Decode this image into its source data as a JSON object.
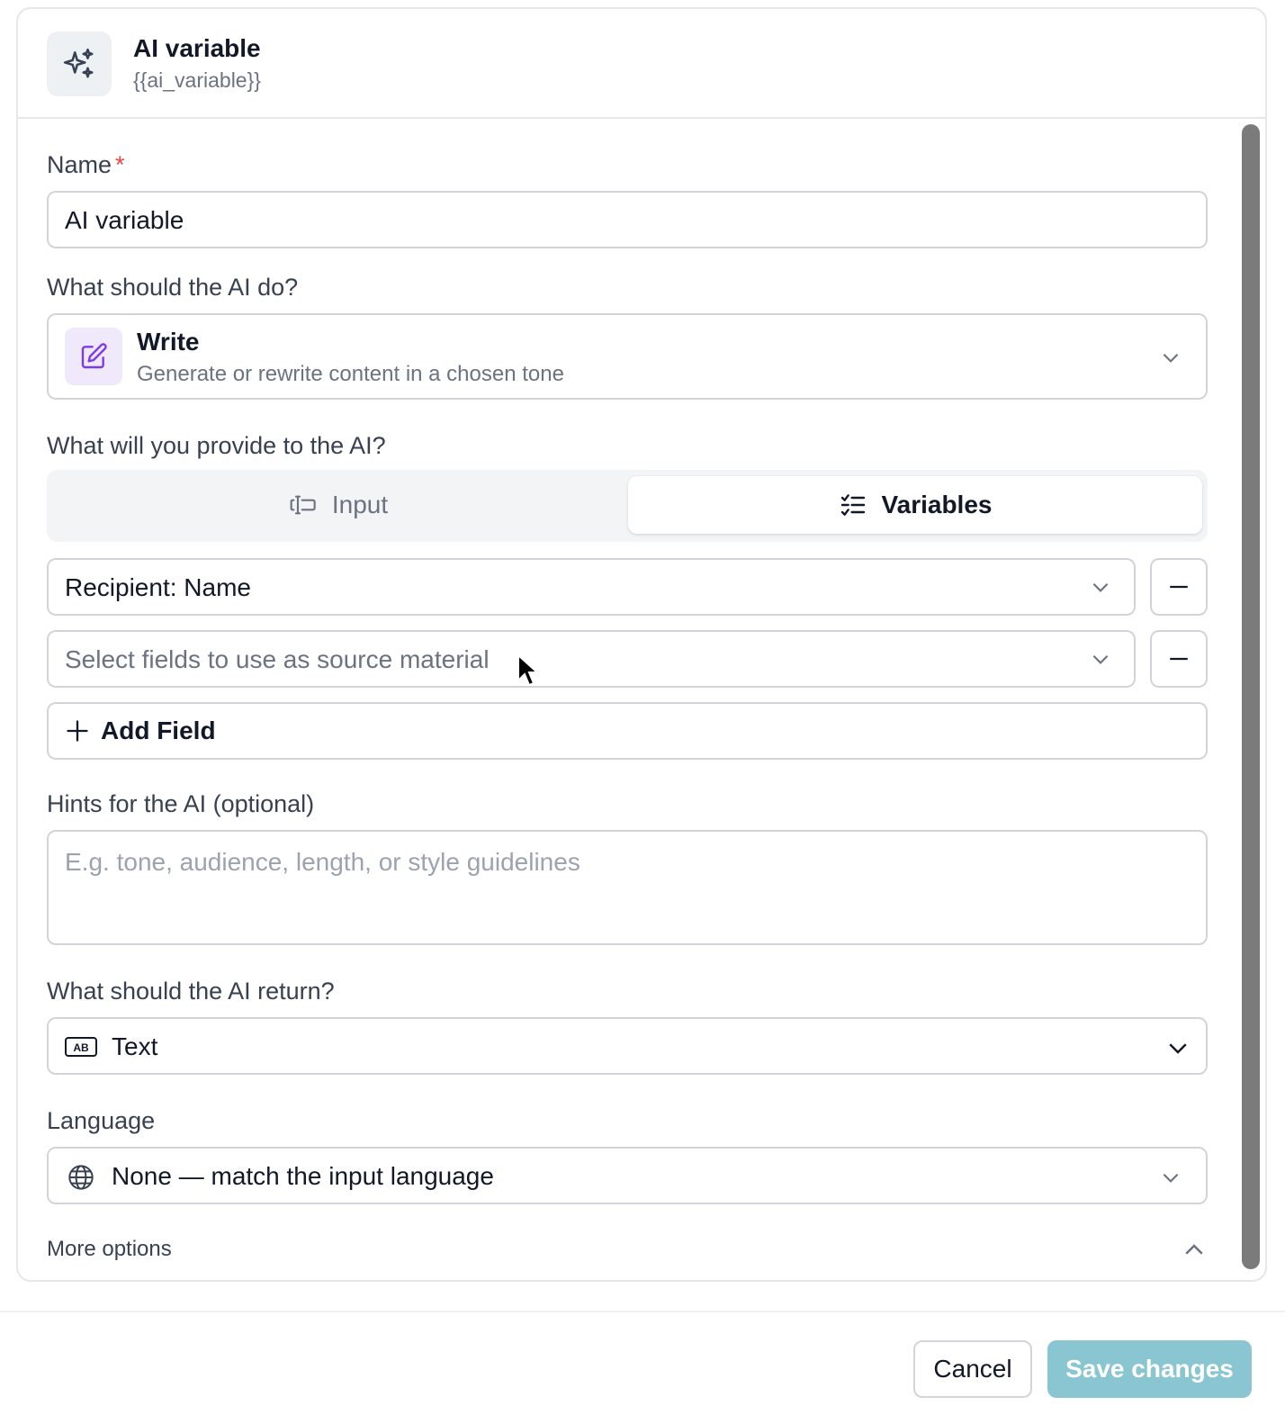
{
  "header": {
    "title": "AI variable",
    "subtitle": "{{ai_variable}}",
    "icon": "sparkles-icon"
  },
  "name_field": {
    "label": "Name",
    "required_mark": "*",
    "value": "AI variable"
  },
  "action": {
    "label": "What should the AI do?",
    "selected_title": "Write",
    "selected_description": "Generate or rewrite content in a chosen tone",
    "icon": "pencil-square-icon"
  },
  "provide": {
    "label": "What will you provide to the AI?",
    "tabs": [
      {
        "label": "Input",
        "icon": "text-cursor-icon",
        "selected": false
      },
      {
        "label": "Variables",
        "icon": "checklist-icon",
        "selected": true
      }
    ],
    "fields": [
      {
        "value": "Recipient: Name",
        "placeholder": ""
      },
      {
        "value": "",
        "placeholder": "Select fields to use as source material"
      }
    ],
    "add_field_label": "Add Field"
  },
  "hints": {
    "label": "Hints for the AI (optional)",
    "placeholder": "E.g. tone, audience, length, or style guidelines"
  },
  "return_type": {
    "label": "What should the AI return?",
    "selected": "Text",
    "icon": "text-ab-icon"
  },
  "language": {
    "label": "Language",
    "selected": "None — match the input language",
    "icon": "globe-icon"
  },
  "more_options": {
    "label": "More options"
  },
  "footer": {
    "cancel_label": "Cancel",
    "save_label": "Save changes"
  },
  "colors": {
    "accent": "#7c3aed",
    "required": "#ef4444",
    "save_disabled": "#8ac6d1"
  }
}
